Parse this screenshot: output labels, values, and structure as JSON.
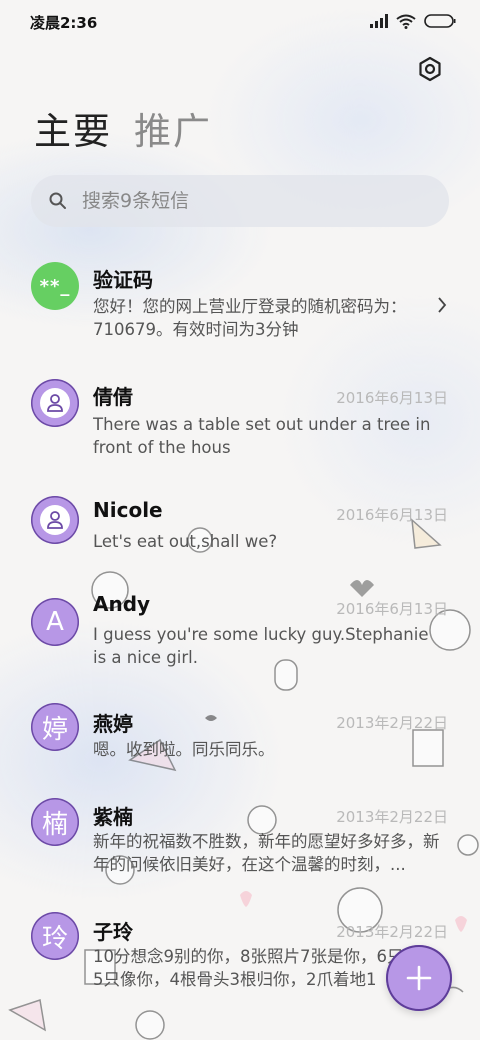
{
  "status": {
    "time": "凌晨2:36"
  },
  "tabs": [
    {
      "label": "主要"
    },
    {
      "label": "推广"
    }
  ],
  "search": {
    "placeholder": "搜索9条短信"
  },
  "messages": [
    {
      "name": "验证码",
      "avatar_text": "**_",
      "avatar_type": "code",
      "date": "",
      "preview": "您好！您的网上营业厅登录的随机密码为：710679。有效时间为3分钟"
    },
    {
      "name": "倩倩",
      "avatar_text": "",
      "avatar_type": "person",
      "date": "2016年6月13日",
      "preview": "There was a table set out under a tree in front of the hous"
    },
    {
      "name": "Nicole",
      "avatar_text": "",
      "avatar_type": "person",
      "date": "2016年6月13日",
      "preview": "Let's eat out,shall we?"
    },
    {
      "name": "Andy",
      "avatar_text": "A",
      "avatar_type": "letter",
      "date": "2016年6月13日",
      "preview": "I guess you're some lucky guy.Stephanie is a nice girl."
    },
    {
      "name": "燕婷",
      "avatar_text": "婷",
      "avatar_type": "letter",
      "date": "2013年2月22日",
      "preview": "嗯。收到啦。同乐同乐。"
    },
    {
      "name": "紫楠",
      "avatar_text": "楠",
      "avatar_type": "letter",
      "date": "2013年2月22日",
      "preview": "新年的祝福数不胜数，新年的愿望好多好多，新年的问候依旧美好，在这个温馨的时刻，..."
    },
    {
      "name": "子玲",
      "avatar_text": "玲",
      "avatar_type": "letter",
      "date": "2013年2月22日",
      "preview": "10分想念9别的你，8张照片7张是你，6只小狗5只像你，4根骨头3根归你，2爪着地1"
    }
  ],
  "colors": {
    "avatar_purple": "#b797e6",
    "avatar_green": "#66cf62",
    "fab": "#b797e6"
  },
  "icons": {
    "settings": "gear-icon",
    "search": "search-icon",
    "compose": "plus-icon"
  }
}
